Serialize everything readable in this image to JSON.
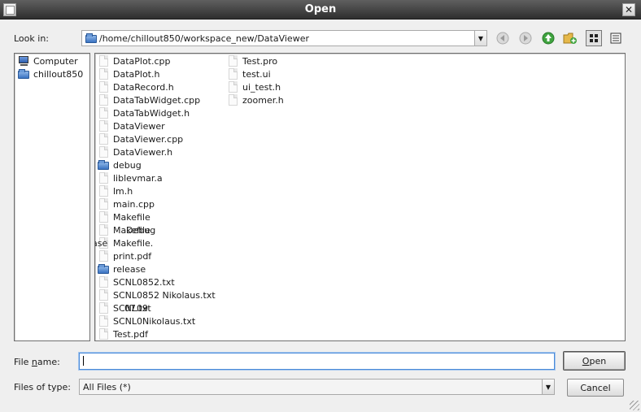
{
  "window": {
    "title": "Open"
  },
  "look_in": {
    "label": "Look in:",
    "path": "/home/chillout850/workspace_new/DataViewer"
  },
  "toolbar": {
    "back_icon": "back-arrow-icon",
    "forward_icon": "forward-arrow-icon",
    "up_icon": "up-arrow-icon",
    "new_folder_icon": "new-folder-icon",
    "list_view_icon": "list-view-icon",
    "detail_view_icon": "detail-view-icon"
  },
  "sidebar": {
    "items": [
      {
        "label": "Computer",
        "icon": "computer-icon"
      },
      {
        "label": "chillout850",
        "icon": "folder-icon"
      }
    ]
  },
  "files": {
    "column1": [
      {
        "name": "DataPlot.cpp",
        "type": "file"
      },
      {
        "name": "DataPlot.h",
        "type": "file"
      },
      {
        "name": "DataRecord.h",
        "type": "file"
      },
      {
        "name": "DataTabWidget.cpp",
        "type": "file"
      },
      {
        "name": "DataTabWidget.h",
        "type": "file"
      },
      {
        "name": "DataViewer",
        "type": "file"
      },
      {
        "name": "DataViewer.cpp",
        "type": "file"
      },
      {
        "name": "DataViewer.h",
        "type": "file"
      },
      {
        "name": "debug",
        "type": "folder"
      },
      {
        "name": "liblevmar.a",
        "type": "file"
      },
      {
        "name": "lm.h",
        "type": "file"
      },
      {
        "name": "main.cpp",
        "type": "file"
      },
      {
        "name": "Makefile",
        "type": "file"
      },
      {
        "name": "Makefile",
        "type": "file"
      },
      {
        "name": "Makefile.",
        "type": "file"
      },
      {
        "name": "print.pdf",
        "type": "file"
      },
      {
        "name": "release",
        "type": "folder"
      },
      {
        "name": "SCNL0852.txt",
        "type": "file"
      },
      {
        "name": "SCNL0852 Nikolaus.txt",
        "type": "file"
      },
      {
        "name": "SCNL09",
        "type": "file"
      },
      {
        "name": "SCNL0Nikolaus.txt",
        "type": "file"
      },
      {
        "name": "Test.pdf",
        "type": "file"
      }
    ],
    "column2": [
      {
        "name": "Test.pro",
        "type": "file"
      },
      {
        "name": "test.ui",
        "type": "file"
      },
      {
        "name": "ui_test.h",
        "type": "file"
      },
      {
        "name": "zoomer.h",
        "type": "file"
      }
    ],
    "overlaps": [
      {
        "text": "Debug"
      },
      {
        "text": "ase"
      },
      {
        "text": "07.txt"
      }
    ]
  },
  "file_name": {
    "label_prefix": "File ",
    "label_accel": "n",
    "label_suffix": "ame:",
    "value": ""
  },
  "files_of_type": {
    "label": "Files of type:",
    "selected": "All Files (*)"
  },
  "buttons": {
    "open_accel": "O",
    "open_rest": "pen",
    "cancel": "Cancel"
  }
}
